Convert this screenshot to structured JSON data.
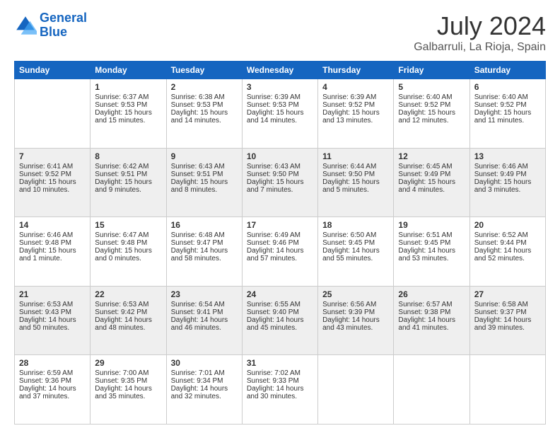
{
  "logo": {
    "line1": "General",
    "line2": "Blue"
  },
  "title": "July 2024",
  "subtitle": "Galbarruli, La Rioja, Spain",
  "days_of_week": [
    "Sunday",
    "Monday",
    "Tuesday",
    "Wednesday",
    "Thursday",
    "Friday",
    "Saturday"
  ],
  "weeks": [
    [
      {
        "day": "",
        "sunrise": "",
        "sunset": "",
        "daylight": ""
      },
      {
        "day": "1",
        "sunrise": "Sunrise: 6:37 AM",
        "sunset": "Sunset: 9:53 PM",
        "daylight": "Daylight: 15 hours and 15 minutes."
      },
      {
        "day": "2",
        "sunrise": "Sunrise: 6:38 AM",
        "sunset": "Sunset: 9:53 PM",
        "daylight": "Daylight: 15 hours and 14 minutes."
      },
      {
        "day": "3",
        "sunrise": "Sunrise: 6:39 AM",
        "sunset": "Sunset: 9:53 PM",
        "daylight": "Daylight: 15 hours and 14 minutes."
      },
      {
        "day": "4",
        "sunrise": "Sunrise: 6:39 AM",
        "sunset": "Sunset: 9:52 PM",
        "daylight": "Daylight: 15 hours and 13 minutes."
      },
      {
        "day": "5",
        "sunrise": "Sunrise: 6:40 AM",
        "sunset": "Sunset: 9:52 PM",
        "daylight": "Daylight: 15 hours and 12 minutes."
      },
      {
        "day": "6",
        "sunrise": "Sunrise: 6:40 AM",
        "sunset": "Sunset: 9:52 PM",
        "daylight": "Daylight: 15 hours and 11 minutes."
      }
    ],
    [
      {
        "day": "7",
        "sunrise": "Sunrise: 6:41 AM",
        "sunset": "Sunset: 9:52 PM",
        "daylight": "Daylight: 15 hours and 10 minutes."
      },
      {
        "day": "8",
        "sunrise": "Sunrise: 6:42 AM",
        "sunset": "Sunset: 9:51 PM",
        "daylight": "Daylight: 15 hours and 9 minutes."
      },
      {
        "day": "9",
        "sunrise": "Sunrise: 6:43 AM",
        "sunset": "Sunset: 9:51 PM",
        "daylight": "Daylight: 15 hours and 8 minutes."
      },
      {
        "day": "10",
        "sunrise": "Sunrise: 6:43 AM",
        "sunset": "Sunset: 9:50 PM",
        "daylight": "Daylight: 15 hours and 7 minutes."
      },
      {
        "day": "11",
        "sunrise": "Sunrise: 6:44 AM",
        "sunset": "Sunset: 9:50 PM",
        "daylight": "Daylight: 15 hours and 5 minutes."
      },
      {
        "day": "12",
        "sunrise": "Sunrise: 6:45 AM",
        "sunset": "Sunset: 9:49 PM",
        "daylight": "Daylight: 15 hours and 4 minutes."
      },
      {
        "day": "13",
        "sunrise": "Sunrise: 6:46 AM",
        "sunset": "Sunset: 9:49 PM",
        "daylight": "Daylight: 15 hours and 3 minutes."
      }
    ],
    [
      {
        "day": "14",
        "sunrise": "Sunrise: 6:46 AM",
        "sunset": "Sunset: 9:48 PM",
        "daylight": "Daylight: 15 hours and 1 minute."
      },
      {
        "day": "15",
        "sunrise": "Sunrise: 6:47 AM",
        "sunset": "Sunset: 9:48 PM",
        "daylight": "Daylight: 15 hours and 0 minutes."
      },
      {
        "day": "16",
        "sunrise": "Sunrise: 6:48 AM",
        "sunset": "Sunset: 9:47 PM",
        "daylight": "Daylight: 14 hours and 58 minutes."
      },
      {
        "day": "17",
        "sunrise": "Sunrise: 6:49 AM",
        "sunset": "Sunset: 9:46 PM",
        "daylight": "Daylight: 14 hours and 57 minutes."
      },
      {
        "day": "18",
        "sunrise": "Sunrise: 6:50 AM",
        "sunset": "Sunset: 9:45 PM",
        "daylight": "Daylight: 14 hours and 55 minutes."
      },
      {
        "day": "19",
        "sunrise": "Sunrise: 6:51 AM",
        "sunset": "Sunset: 9:45 PM",
        "daylight": "Daylight: 14 hours and 53 minutes."
      },
      {
        "day": "20",
        "sunrise": "Sunrise: 6:52 AM",
        "sunset": "Sunset: 9:44 PM",
        "daylight": "Daylight: 14 hours and 52 minutes."
      }
    ],
    [
      {
        "day": "21",
        "sunrise": "Sunrise: 6:53 AM",
        "sunset": "Sunset: 9:43 PM",
        "daylight": "Daylight: 14 hours and 50 minutes."
      },
      {
        "day": "22",
        "sunrise": "Sunrise: 6:53 AM",
        "sunset": "Sunset: 9:42 PM",
        "daylight": "Daylight: 14 hours and 48 minutes."
      },
      {
        "day": "23",
        "sunrise": "Sunrise: 6:54 AM",
        "sunset": "Sunset: 9:41 PM",
        "daylight": "Daylight: 14 hours and 46 minutes."
      },
      {
        "day": "24",
        "sunrise": "Sunrise: 6:55 AM",
        "sunset": "Sunset: 9:40 PM",
        "daylight": "Daylight: 14 hours and 45 minutes."
      },
      {
        "day": "25",
        "sunrise": "Sunrise: 6:56 AM",
        "sunset": "Sunset: 9:39 PM",
        "daylight": "Daylight: 14 hours and 43 minutes."
      },
      {
        "day": "26",
        "sunrise": "Sunrise: 6:57 AM",
        "sunset": "Sunset: 9:38 PM",
        "daylight": "Daylight: 14 hours and 41 minutes."
      },
      {
        "day": "27",
        "sunrise": "Sunrise: 6:58 AM",
        "sunset": "Sunset: 9:37 PM",
        "daylight": "Daylight: 14 hours and 39 minutes."
      }
    ],
    [
      {
        "day": "28",
        "sunrise": "Sunrise: 6:59 AM",
        "sunset": "Sunset: 9:36 PM",
        "daylight": "Daylight: 14 hours and 37 minutes."
      },
      {
        "day": "29",
        "sunrise": "Sunrise: 7:00 AM",
        "sunset": "Sunset: 9:35 PM",
        "daylight": "Daylight: 14 hours and 35 minutes."
      },
      {
        "day": "30",
        "sunrise": "Sunrise: 7:01 AM",
        "sunset": "Sunset: 9:34 PM",
        "daylight": "Daylight: 14 hours and 32 minutes."
      },
      {
        "day": "31",
        "sunrise": "Sunrise: 7:02 AM",
        "sunset": "Sunset: 9:33 PM",
        "daylight": "Daylight: 14 hours and 30 minutes."
      },
      {
        "day": "",
        "sunrise": "",
        "sunset": "",
        "daylight": ""
      },
      {
        "day": "",
        "sunrise": "",
        "sunset": "",
        "daylight": ""
      },
      {
        "day": "",
        "sunrise": "",
        "sunset": "",
        "daylight": ""
      }
    ]
  ]
}
